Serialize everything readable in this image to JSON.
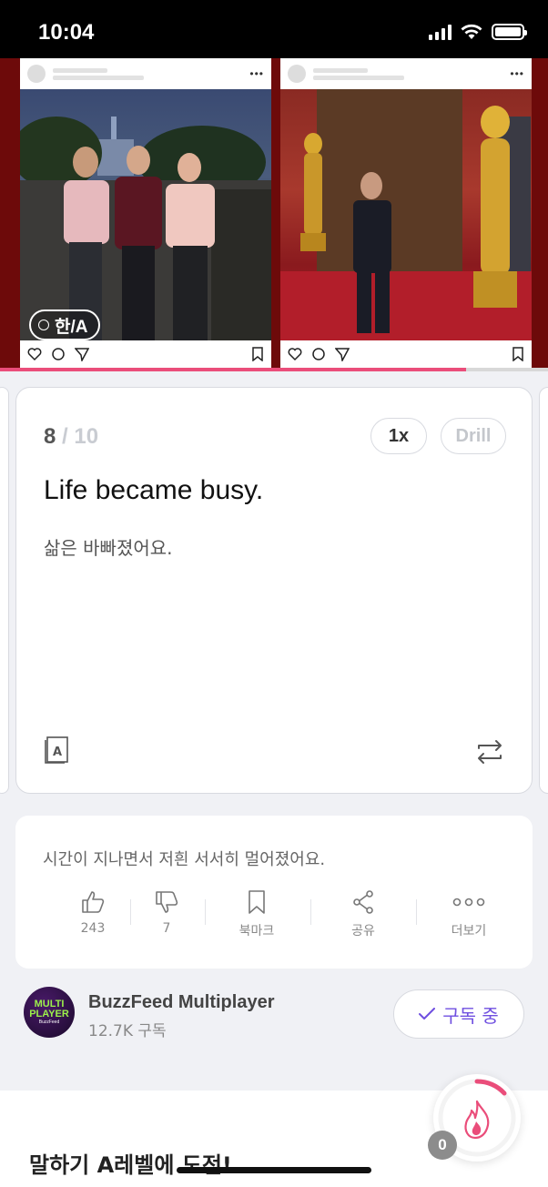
{
  "status_bar": {
    "time": "10:04"
  },
  "video": {
    "translate_chip": "한/A",
    "progress_fraction": 0.85
  },
  "card": {
    "current": "8",
    "total": "/ 10",
    "speed_label": "1x",
    "drill_label": "Drill",
    "english": "Life became busy.",
    "korean": "삶은 바빠졌어요."
  },
  "comment": {
    "text": "시간이 지나면서 저흰 서서히 멀어졌어요.",
    "actions": [
      {
        "icon": "thumbs-up-icon",
        "label": "243"
      },
      {
        "icon": "thumbs-down-icon",
        "label": "7"
      },
      {
        "icon": "bookmark-icon",
        "label": "북마크"
      },
      {
        "icon": "share-icon",
        "label": "공유"
      },
      {
        "icon": "more-icon",
        "label": "더보기"
      }
    ]
  },
  "channel": {
    "logo_line1": "MULTI",
    "logo_line2": "PLAYER",
    "logo_sub": "BuzzFeed",
    "name": "BuzzFeed Multiplayer",
    "subscribers": "12.7K 구독",
    "subscribe_label": "구독 중"
  },
  "bottom": {
    "title": "말하기 A레벨에 도전!",
    "streak_count": "0"
  },
  "colors": {
    "accent": "#ea4d7a",
    "subscribe": "#6f4fe0"
  }
}
